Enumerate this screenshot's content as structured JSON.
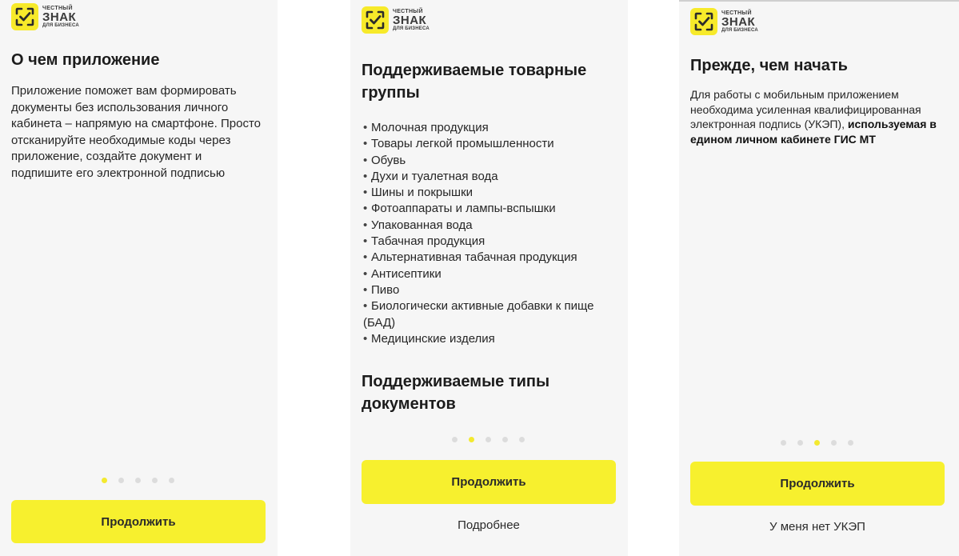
{
  "brand": {
    "line1": "ЧЕСТНЫЙ",
    "line2": "ЗНАК",
    "line3": "ДЛЯ БИЗНЕСА",
    "accent_color": "#f7f02e"
  },
  "screen1": {
    "title": "О чем приложение",
    "body": "Приложение поможет вам формировать документы без использования личного кабинета – напрямую на смартфоне. Просто отсканируйте необходимые коды через приложение, создайте документ и подпишите его электронной подписью",
    "active_dot": 1,
    "dots_total": 5,
    "continue_label": "Продолжить"
  },
  "screen2": {
    "title": "Поддерживаемые товарные группы",
    "items": [
      "Молочная продукция",
      "Товары легкой промышленности",
      "Обувь",
      "Духи и туалетная вода",
      "Шины и покрышки",
      "Фотоаппараты и лампы-вспышки",
      "Упакованная вода",
      "Табачная продукция",
      "Альтернативная табачная продукция",
      "Антисептики",
      "Пиво",
      "Биологически активные добавки к пище (БАД)",
      "Медицинские изделия"
    ],
    "subtitle": "Поддерживаемые типы документов",
    "active_dot": 2,
    "dots_total": 5,
    "continue_label": "Продолжить",
    "more_label": "Подробнее"
  },
  "screen3": {
    "title": "Прежде, чем начать",
    "body_plain": "Для работы с мобильным приложением необходима усиленная квалифицированная электронная подпись (УКЭП), ",
    "body_bold": "используемая в едином личном кабинете ГИС МТ",
    "active_dot": 3,
    "dots_total": 5,
    "continue_label": "Продолжить",
    "no_key_label": "У меня нет УКЭП"
  }
}
